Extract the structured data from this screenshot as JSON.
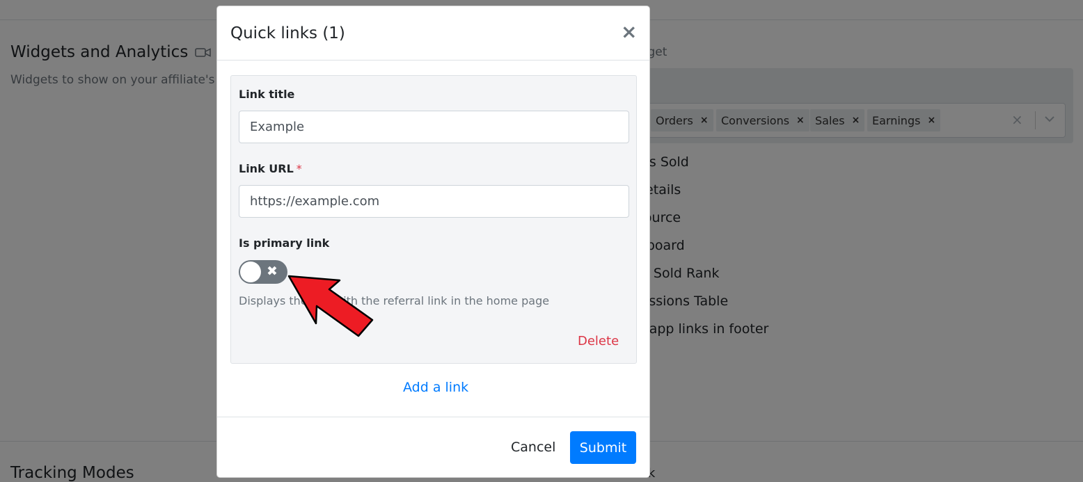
{
  "background": {
    "section_title": "Widgets and Analytics",
    "section_icon": "video-camera-icon",
    "section_desc": "Widgets to show on your affiliate's",
    "widget_label_partial": "idget",
    "chips": [
      "Orders",
      "Conversions",
      "Sales",
      "Earnings"
    ],
    "chip_remove": "×",
    "select_clear": "×",
    "widget_items": [
      "cts Sold",
      " details",
      " source",
      "r board",
      "ct Sold Rank",
      "nissions Table",
      "e app links in footer"
    ],
    "tracking_title": "Tracking Modes",
    "referral_partial": "Referral Link"
  },
  "modal": {
    "title": "Quick links (1)",
    "close_symbol": "×",
    "link_title_label": "Link title",
    "link_title_value": "Example",
    "link_url_label": "Link URL",
    "required_mark": "*",
    "link_url_value": "https://example.com",
    "primary_label": "Is primary link",
    "toggle_off_symbol": "✖",
    "help_text": "Displays the link with the referral link in the home page",
    "delete_label": "Delete",
    "add_link_label": "Add a link",
    "cancel_label": "Cancel",
    "submit_label": "Submit"
  },
  "annotation": {
    "icon": "red-arrow-icon",
    "color": "#ed1c24"
  }
}
